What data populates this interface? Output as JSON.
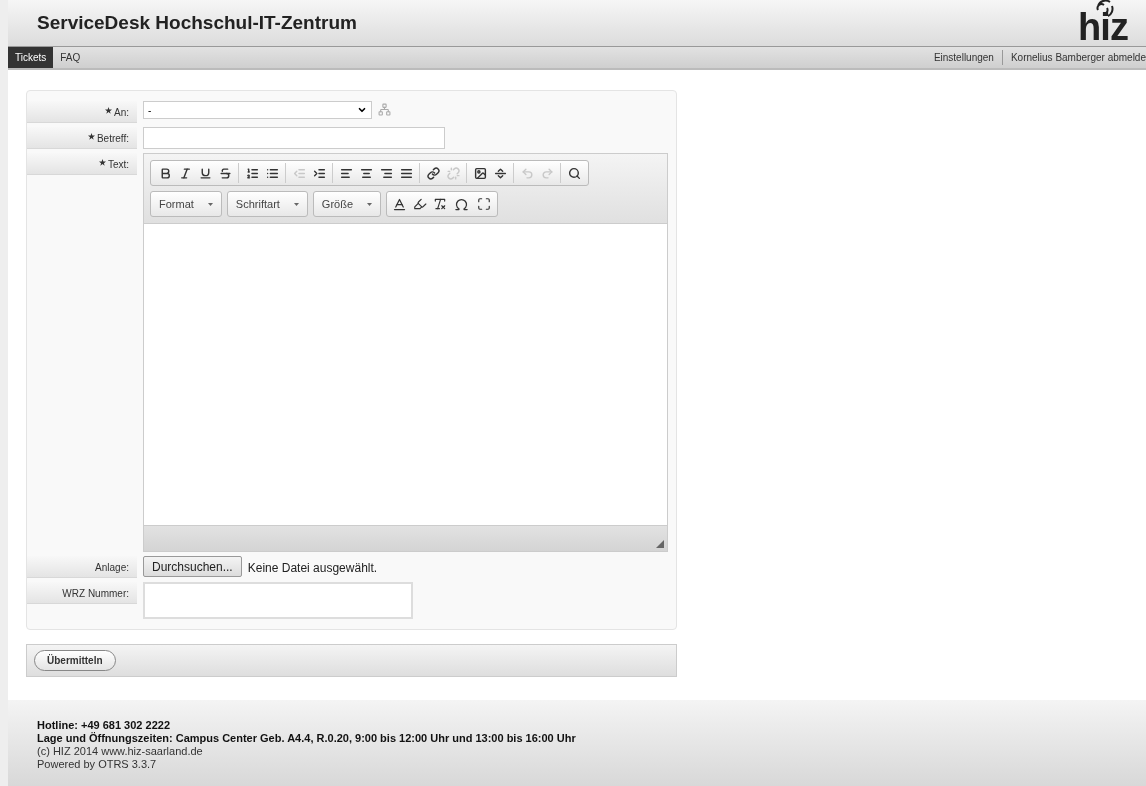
{
  "header": {
    "title": "ServiceDesk Hochschul-IT-Zentrum",
    "logo": "hiz"
  },
  "nav": {
    "tabs": [
      {
        "label": "Tickets",
        "selected": true
      },
      {
        "label": "FAQ",
        "selected": false
      }
    ],
    "links": [
      "Einstellungen",
      "Kornelius Bamberger abmelde"
    ]
  },
  "form": {
    "to": {
      "label": "An:",
      "required": true,
      "value": "-"
    },
    "subject": {
      "label": "Betreff:",
      "required": true
    },
    "text": {
      "label": "Text:",
      "required": true,
      "toolbar": [
        [
          {
            "kind": "bold",
            "disabled": false
          },
          {
            "kind": "italic",
            "disabled": false
          },
          {
            "kind": "underline",
            "disabled": false
          },
          {
            "kind": "strike",
            "disabled": false
          }
        ],
        [
          {
            "kind": "ol",
            "disabled": false
          },
          {
            "kind": "ul",
            "disabled": false
          }
        ],
        [
          {
            "kind": "outdent",
            "disabled": true
          },
          {
            "kind": "indent",
            "disabled": false
          }
        ],
        [
          {
            "kind": "left",
            "disabled": false
          },
          {
            "kind": "center",
            "disabled": false
          },
          {
            "kind": "right",
            "disabled": false
          },
          {
            "kind": "justify",
            "disabled": false
          }
        ],
        [
          {
            "kind": "link",
            "disabled": false
          },
          {
            "kind": "unlink",
            "disabled": true
          }
        ],
        [
          {
            "kind": "image",
            "disabled": false
          },
          {
            "kind": "hr",
            "disabled": false
          }
        ],
        [
          {
            "kind": "undo",
            "disabled": true
          },
          {
            "kind": "redo",
            "disabled": true
          }
        ],
        [
          {
            "kind": "find",
            "disabled": false
          }
        ]
      ],
      "dropdowns": [
        "Format",
        "Schriftart",
        "Größe"
      ]
    },
    "attachment": {
      "label": "Anlage:",
      "required": false,
      "button": "Durchsuchen...",
      "status": "Keine Datei ausgewählt."
    },
    "wrz": {
      "label": "WRZ Nummer:",
      "required": false
    },
    "submit": "Übermitteln"
  },
  "footer": {
    "hotline": "Hotline: +49 681 302 2222",
    "location": "Lage und Öffnungszeiten: Campus Center Geb. A4.4, R.0.20, 9:00 bis 12:00 Uhr und 13:00 bis 16:00 Uhr",
    "copyright": "(c) HIZ 2014 www.hiz-saarland.de",
    "powered": "Powered by OTRS 3.3.7"
  }
}
